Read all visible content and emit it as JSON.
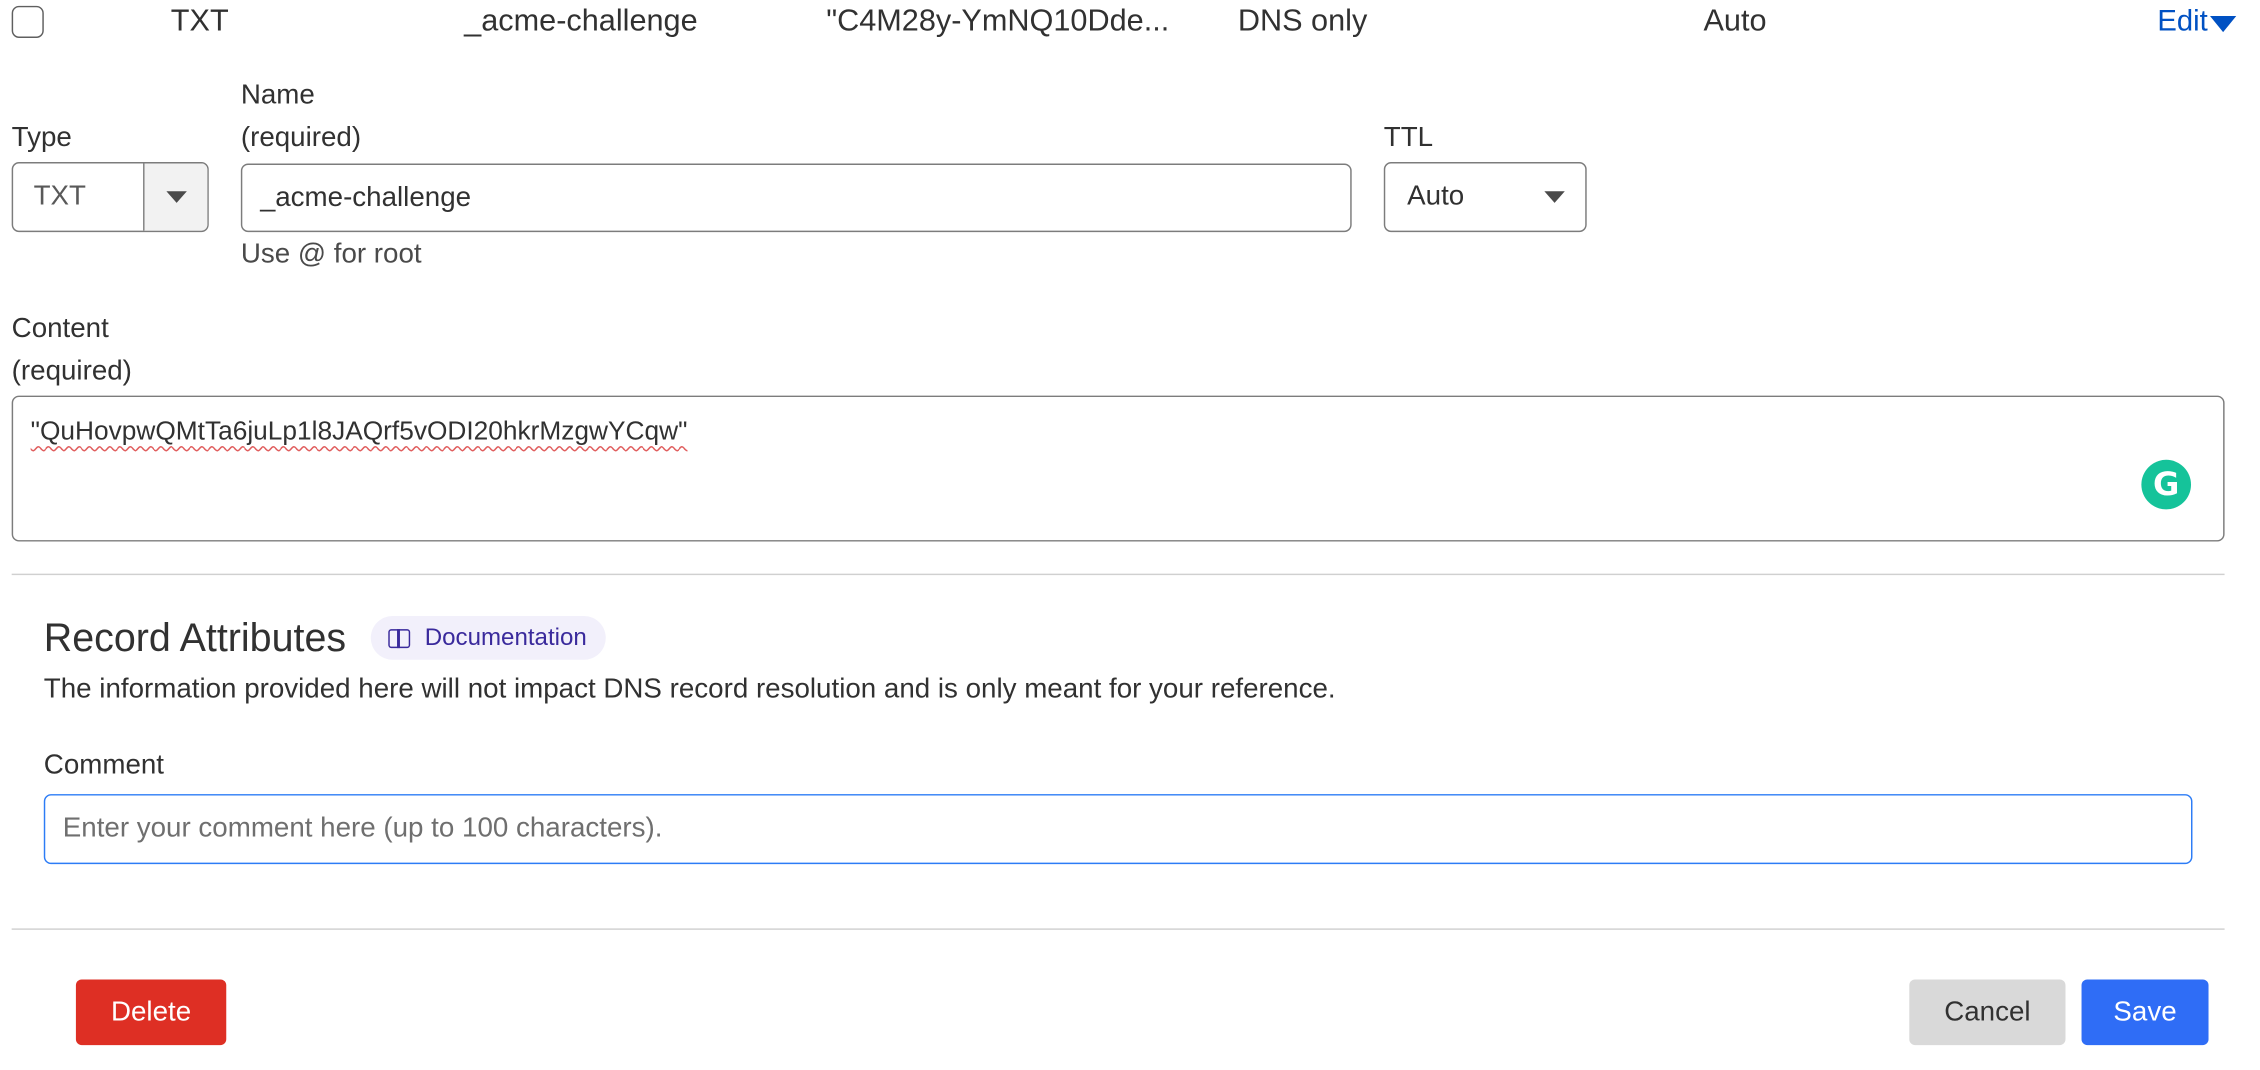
{
  "row": {
    "type": "TXT",
    "name": "_acme-challenge",
    "content": "\"C4M28y-YmNQ10Dde...",
    "proxy_status": "DNS only",
    "ttl": "Auto",
    "edit_label": "Edit"
  },
  "form": {
    "type_label": "Type",
    "type_value": "TXT",
    "name_label": "Name",
    "name_required": "(required)",
    "name_value": "_acme-challenge",
    "name_hint": "Use @ for root",
    "ttl_label": "TTL",
    "ttl_value": "Auto",
    "content_label": "Content",
    "content_required": "(required)",
    "content_value": "\"QuHovpwQMtTa6juLp1l8JAQrf5vODI20hkrMzgwYCqw\"",
    "grammarly_letter": "G"
  },
  "attributes": {
    "title": "Record Attributes",
    "doc_label": "Documentation",
    "description": "The information provided here will not impact DNS record resolution and is only meant for your reference.",
    "comment_label": "Comment",
    "comment_placeholder": "Enter your comment here (up to 100 characters)."
  },
  "actions": {
    "delete_label": "Delete",
    "cancel_label": "Cancel",
    "save_label": "Save"
  },
  "colors": {
    "link": "#0051c3",
    "delete": "#de2f24",
    "save": "#2f6df6",
    "focus": "#2c7cf6"
  }
}
